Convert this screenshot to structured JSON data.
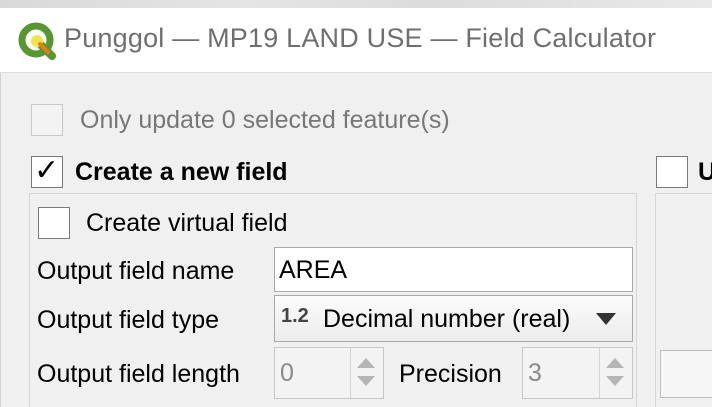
{
  "window": {
    "title": "Punggol — MP19 LAND USE — Field Calculator",
    "icon": "qgis-logo-icon"
  },
  "options": {
    "only_selected_label": "Only update 0 selected feature(s)",
    "only_selected_checked": false,
    "only_selected_enabled": false,
    "create_new_field_label": "Create a new field",
    "create_new_field_checked": true,
    "create_new_field_mark": "✓",
    "update_existing_label_partial": "U",
    "update_existing_checked": false
  },
  "new_field": {
    "virtual_label": "Create virtual field",
    "virtual_checked": false,
    "name_label": "Output field name",
    "name_value": "AREA",
    "type_label": "Output field type",
    "type_icon_text": "1.2",
    "type_value": "Decimal number (real)",
    "length_label": "Output field length",
    "length_value": "0",
    "precision_label": "Precision",
    "precision_value": "3"
  },
  "colors": {
    "title_text": "#6f6f6f",
    "disabled_text": "#777777",
    "qgis_green": "#589632",
    "qgis_yellow": "#ee7913"
  }
}
